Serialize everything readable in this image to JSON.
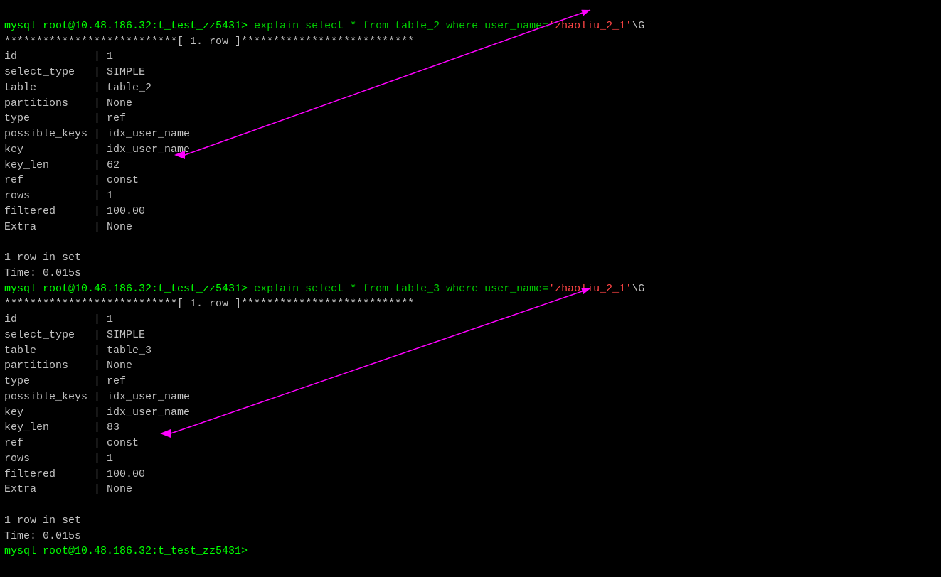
{
  "terminal": {
    "prompt1": "mysql root@10.48.186.32:t_test_zz5431>",
    "cmd1_keyword": "explain select * from table_2",
    "cmd1_where": "where",
    "cmd1_value": "'zhaoliu_2_1'",
    "cmd1_suffix": "\\G",
    "separator1": "***************************[ 1. row ]***************************",
    "row1": [
      {
        "field": "id",
        "value": "1"
      },
      {
        "field": "select_type",
        "value": "SIMPLE"
      },
      {
        "field": "table",
        "value": "table_2"
      },
      {
        "field": "partitions",
        "value": "None"
      },
      {
        "field": "type",
        "value": "ref"
      },
      {
        "field": "possible_keys",
        "value": "idx_user_name"
      },
      {
        "field": "key",
        "value": "idx_user_name"
      },
      {
        "field": "key_len",
        "value": "62"
      },
      {
        "field": "ref",
        "value": "const"
      },
      {
        "field": "rows",
        "value": "1"
      },
      {
        "field": "filtered",
        "value": "100.00"
      },
      {
        "field": "Extra",
        "value": "None"
      }
    ],
    "result1": "1 row in set",
    "time1": "Time: 0.015s",
    "prompt2": "mysql root@10.48.186.32:t_test_zz5431>",
    "cmd2_keyword": "explain select * from table_3",
    "cmd2_where": "where",
    "cmd2_value": "'zhaoliu_2_1'",
    "cmd2_suffix": "\\G",
    "separator2": "***************************[ 1. row ]***************************",
    "row2": [
      {
        "field": "id",
        "value": "1"
      },
      {
        "field": "select_type",
        "value": "SIMPLE"
      },
      {
        "field": "table",
        "value": "table_3"
      },
      {
        "field": "partitions",
        "value": "None"
      },
      {
        "field": "type",
        "value": "ref"
      },
      {
        "field": "possible_keys",
        "value": "idx_user_name"
      },
      {
        "field": "key",
        "value": "idx_user_name"
      },
      {
        "field": "key_len",
        "value": "83"
      },
      {
        "field": "ref",
        "value": "const"
      },
      {
        "field": "rows",
        "value": "1"
      },
      {
        "field": "filtered",
        "value": "100.00"
      },
      {
        "field": "Extra",
        "value": "None"
      }
    ],
    "result2": "1 row in set",
    "time2": "Time: 0.015s",
    "prompt3": "mysql root@10.48.186.32:t_test_zz5431>"
  }
}
